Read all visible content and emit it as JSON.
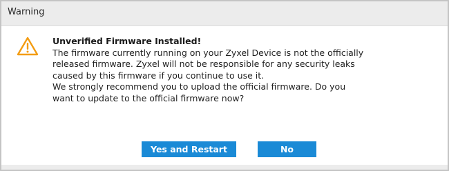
{
  "dialog": {
    "title": "Warning",
    "icon": "warning-triangle-icon",
    "heading": "Unverified Firmware Installed!",
    "lines": [
      "The firmware currently running on your Zyxel Device is not the officially",
      "released firmware. Zyxel will not be responsible for any security leaks",
      "caused by this firmware if you continue to use it.",
      "We strongly recommend you to upload the official firmware. Do you",
      "want to update to the official firmware now?"
    ],
    "buttons": {
      "yes_label": "Yes and Restart",
      "no_label": "No"
    }
  },
  "colors": {
    "accent": "#1a8ad6",
    "warning": "#f39c12",
    "titlebar_bg": "#ececec"
  }
}
